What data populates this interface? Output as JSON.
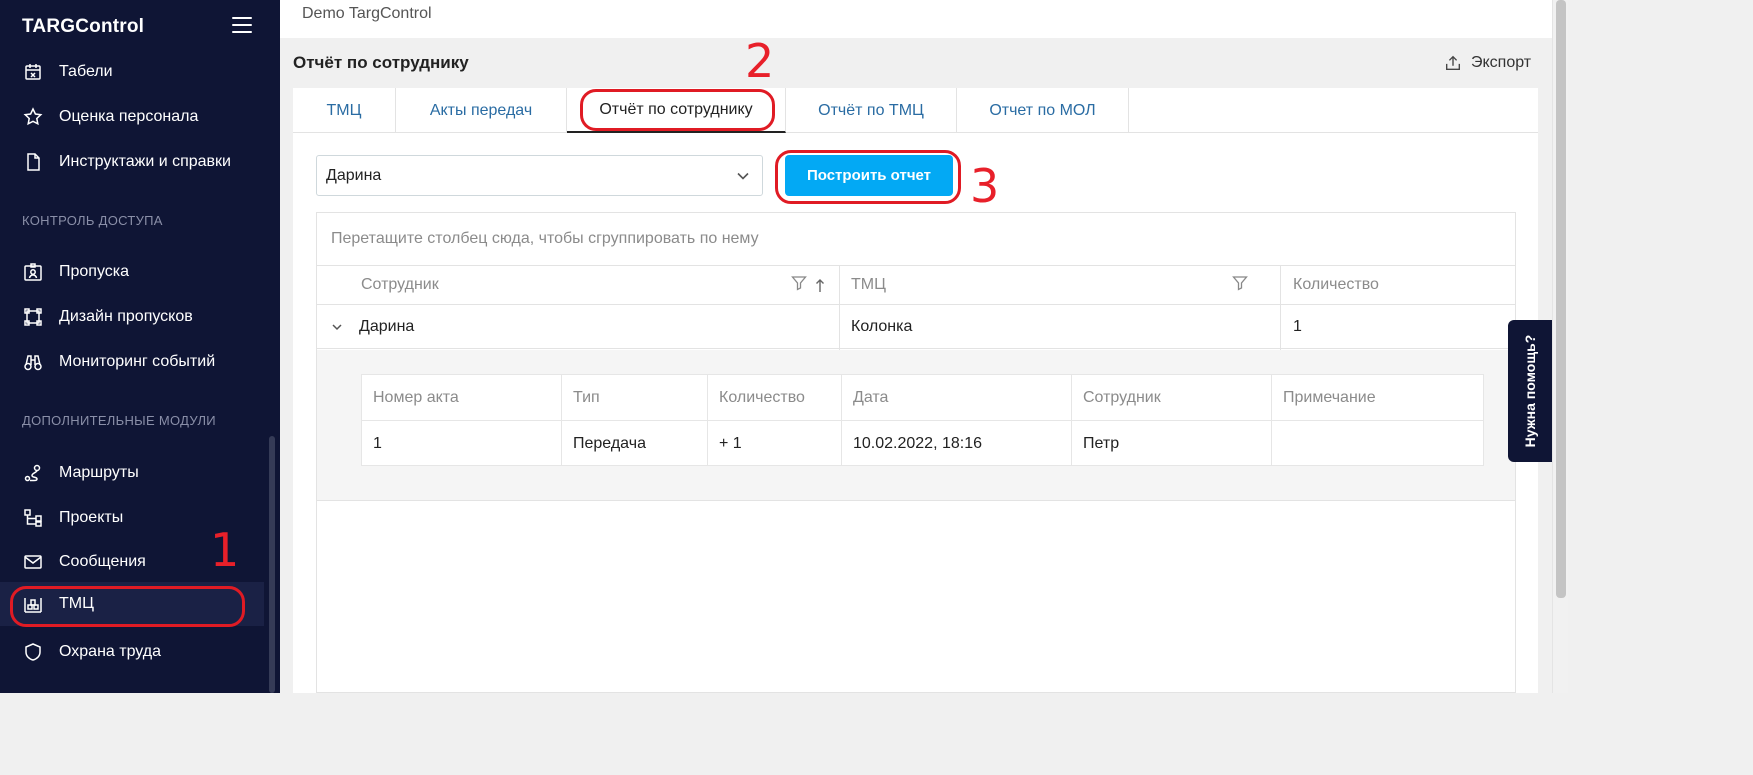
{
  "app": {
    "brand": "TARGControl",
    "workspace": "Demo TargControl"
  },
  "sidebar": {
    "items_top": [
      {
        "label": "Табели",
        "icon": "calendar-x-icon"
      },
      {
        "label": "Оценка персонала",
        "icon": "star-icon"
      },
      {
        "label": "Инструктажи и справки",
        "icon": "document-icon"
      }
    ],
    "section_access": "КОНТРОЛЬ ДОСТУПА",
    "items_access": [
      {
        "label": "Пропуска",
        "icon": "badge-icon"
      },
      {
        "label": "Дизайн пропусков",
        "icon": "design-frame-icon"
      },
      {
        "label": "Мониторинг событий",
        "icon": "binoculars-icon"
      }
    ],
    "section_modules": "ДОПОЛНИТЕЛЬНЫЕ МОДУЛИ",
    "items_modules": [
      {
        "label": "Маршруты",
        "icon": "route-icon"
      },
      {
        "label": "Проекты",
        "icon": "hierarchy-icon"
      },
      {
        "label": "Сообщения",
        "icon": "envelope-icon"
      },
      {
        "label": "ТМЦ",
        "icon": "warehouse-icon",
        "active": true
      },
      {
        "label": "Охрана труда",
        "icon": "shield-icon"
      }
    ]
  },
  "page": {
    "title": "Отчёт по сотруднику",
    "export_label": "Экспорт"
  },
  "tabs": [
    "ТМЦ",
    "Акты передач",
    "Отчёт по сотруднику",
    "Отчёт по ТМЦ",
    "Отчет по МОЛ"
  ],
  "active_tab": "Отчёт по сотруднику",
  "filter": {
    "employee": "Дарина",
    "build_button": "Построить отчет"
  },
  "grid": {
    "group_hint": "Перетащите столбец сюда, чтобы сгруппировать по нему",
    "columns": [
      "Сотрудник",
      "ТМЦ",
      "Количество"
    ],
    "rows": [
      {
        "employee": "Дарина",
        "item": "Колонка",
        "quantity": "1"
      }
    ],
    "detail": {
      "columns": [
        "Номер акта",
        "Тип",
        "Количество",
        "Дата",
        "Сотрудник",
        "Примечание"
      ],
      "rows": [
        {
          "act_no": "1",
          "type": "Передача",
          "qty": "+ 1",
          "date": "10.02.2022, 18:16",
          "employee": "Петр",
          "note": ""
        }
      ]
    }
  },
  "help_tab": "Нужна помощь?",
  "annotations": [
    "1",
    "2",
    "3"
  ],
  "colors": {
    "sidebar_bg": "#0f1535",
    "accent_button": "#03a9f4",
    "annotation_red": "#e01b24",
    "tab_link": "#2a6ca3"
  }
}
